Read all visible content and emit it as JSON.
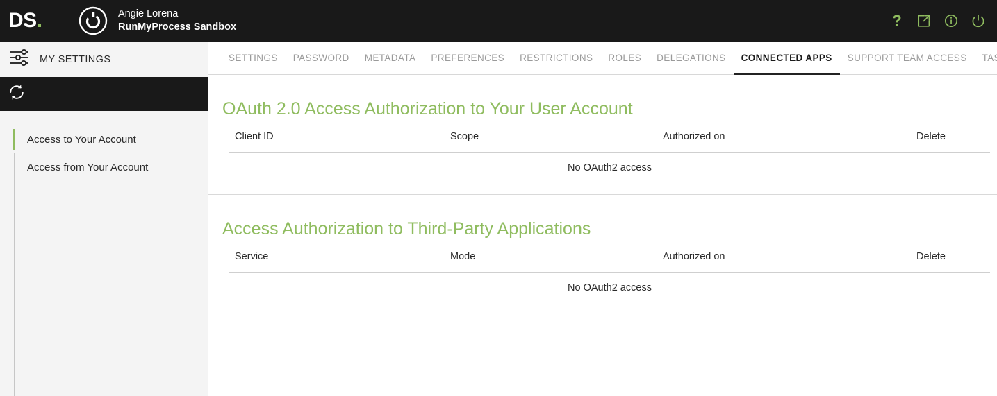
{
  "topbar": {
    "brand_text": "DS",
    "brand_dot": ".",
    "logo_icon": "ds-ring-logo-icon",
    "user_name": "Angie Lorena",
    "tenant_name": "RunMyProcess Sandbox",
    "accent_color": "#8fbc5f",
    "background_color": "#191919",
    "actions": [
      {
        "icon": "help-question-icon",
        "label": "?"
      },
      {
        "icon": "external-link-icon",
        "label": ""
      },
      {
        "icon": "info-icon",
        "label": ""
      },
      {
        "icon": "power-icon",
        "label": ""
      }
    ]
  },
  "sidebar": {
    "settings_icon": "sliders-settings-icon",
    "settings_label": "MY SETTINGS",
    "refresh_icon": "refresh-sync-icon",
    "items": [
      {
        "label": "Access to Your Account",
        "active": true
      },
      {
        "label": "Access from Your Account",
        "active": false
      }
    ]
  },
  "tabs": [
    {
      "label": "SETTINGS",
      "active": false
    },
    {
      "label": "PASSWORD",
      "active": false
    },
    {
      "label": "METADATA",
      "active": false
    },
    {
      "label": "PREFERENCES",
      "active": false
    },
    {
      "label": "RESTRICTIONS",
      "active": false
    },
    {
      "label": "ROLES",
      "active": false
    },
    {
      "label": "DELEGATIONS",
      "active": false
    },
    {
      "label": "CONNECTED APPS",
      "active": true
    },
    {
      "label": "SUPPORT TEAM ACCESS",
      "active": false
    },
    {
      "label": "TASKS",
      "active": false
    }
  ],
  "sections": [
    {
      "title": "OAuth 2.0 Access Authorization to Your User Account",
      "columns": [
        "Client ID",
        "Scope",
        "Authorized on",
        "Delete"
      ],
      "empty_message": "No OAuth2 access"
    },
    {
      "title": "Access Authorization to Third-Party Applications",
      "columns": [
        "Service",
        "Mode",
        "Authorized on",
        "Delete"
      ],
      "empty_message": "No OAuth2 access"
    }
  ]
}
